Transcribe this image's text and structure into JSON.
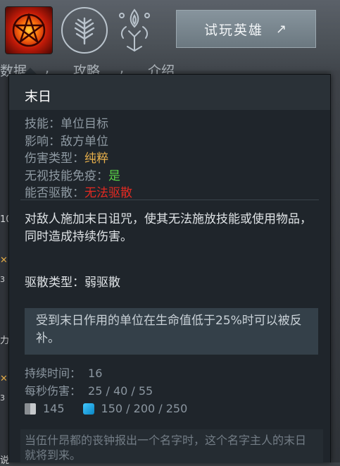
{
  "header": {
    "try_hero_label": "试玩英雄",
    "try_hero_icon": "external-arrow-icon",
    "tabs": [
      "数据",
      "攻略",
      "介绍"
    ],
    "tab_separators": [
      ",",
      ","
    ],
    "abilities": [
      {
        "icon": "doom-pentagram-icon",
        "selected": true
      },
      {
        "icon": "tree-rune-icon",
        "selected": false
      },
      {
        "icon": "flame-totem-icon",
        "selected": false
      }
    ]
  },
  "tooltip": {
    "title": "末日",
    "stats": {
      "ability_label": "技能：",
      "ability_value": "单位目标",
      "affects_label": "影响：",
      "affects_value": "敌方单位",
      "damage_type_label": "伤害类型：",
      "damage_type_value": "纯粹",
      "pierce_label": "无视技能免疫：",
      "pierce_value": "是",
      "dispellable_label": "能否驱散：",
      "dispellable_value": "无法驱散"
    },
    "description": "对敌人施加末日诅咒，使其无法施放技能或使用物品，同时造成持续伤害。",
    "dispel_type": "驱散类型：弱驱散",
    "note": "受到末日作用的单位在生命值低于25%时可以被反补。",
    "values": {
      "duration_label": "持续时间：",
      "duration_value": "16",
      "dps_label": "每秒伤害：",
      "dps_value": "25 / 40 / 55"
    },
    "cooldown": "145",
    "mana_cost": "150 / 200 / 250",
    "lore": "当伍什昂都的丧钟报出一个名字时，这个名字主人的末日就将到来。"
  },
  "colors": {
    "gold": "#e8b04b",
    "green": "#58d046",
    "red": "#e12a22",
    "tooltip_bg": "#1f252b",
    "button_bg": "#7b8890"
  }
}
